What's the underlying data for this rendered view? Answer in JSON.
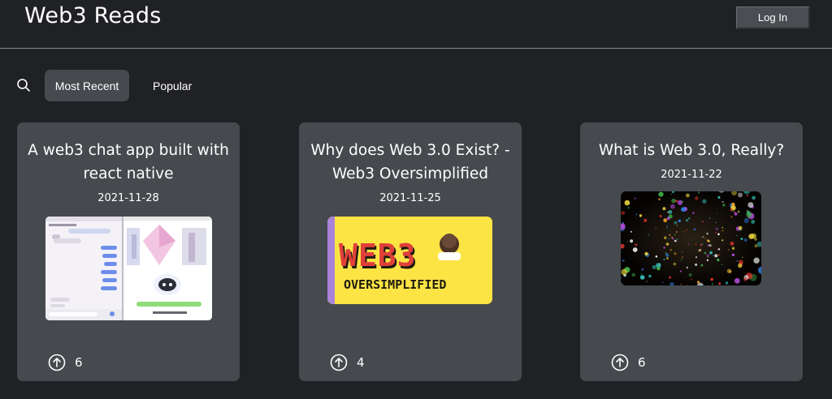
{
  "header": {
    "title": "Web3 Reads",
    "login_label": "Log In"
  },
  "filters": {
    "search_icon": "search-icon",
    "tabs": [
      {
        "label": "Most Recent",
        "active": true
      },
      {
        "label": "Popular",
        "active": false
      }
    ]
  },
  "posts": [
    {
      "title": "A web3 chat app built with react native",
      "date": "2021-11-28",
      "upvotes": "6",
      "thumbnail": "chat-app-screenshot"
    },
    {
      "title": "Why does Web 3.0 Exist? - Web3 Oversimplified",
      "date": "2021-11-25",
      "upvotes": "4",
      "thumbnail": "web3-oversimplified-banner",
      "thumb_text": {
        "big": "WEB3",
        "sub": "OVERSIMPLIFIED"
      }
    },
    {
      "title": "What is Web 3.0, Really?",
      "date": "2021-11-22",
      "upvotes": "6",
      "thumbnail": "colorful-bokeh-particles"
    }
  ],
  "colors": {
    "background": "#202124",
    "card": "#46494d",
    "active_tab": "#46494e",
    "banner_yellow": "#fde445",
    "banner_purple": "#a883d8"
  }
}
